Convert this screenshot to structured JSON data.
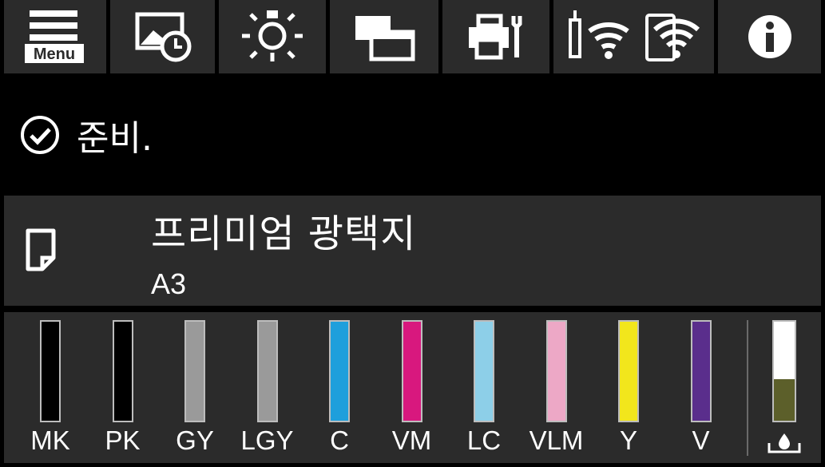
{
  "status": {
    "message": "준비."
  },
  "paper": {
    "type": "프리미엄 광택지",
    "size": "A3"
  },
  "toolbar": {
    "menu_label": "Menu",
    "buttons": [
      "menu-icon",
      "photo-timer-icon",
      "light-icon",
      "layout-icon",
      "printer-maintenance-icon",
      "wifi-icon",
      "wifi-direct-icon",
      "info-icon"
    ]
  },
  "inks": [
    {
      "name": "MK",
      "color": "#000000",
      "level": 1.0
    },
    {
      "name": "PK",
      "color": "#000000",
      "level": 1.0
    },
    {
      "name": "GY",
      "color": "#9a9a9a",
      "level": 1.0
    },
    {
      "name": "LGY",
      "color": "#9a9a9a",
      "level": 1.0
    },
    {
      "name": "C",
      "color": "#1e9fdc",
      "level": 1.0
    },
    {
      "name": "VM",
      "color": "#d8187e",
      "level": 1.0
    },
    {
      "name": "LC",
      "color": "#8dcfe8",
      "level": 1.0
    },
    {
      "name": "VLM",
      "color": "#eda8c6",
      "level": 1.0
    },
    {
      "name": "Y",
      "color": "#f2e61c",
      "level": 1.0
    },
    {
      "name": "V",
      "color": "#5a2e8c",
      "level": 1.0
    }
  ],
  "maintenance_box": {
    "used_level": 0.42,
    "used_color": "#5c5f2a"
  }
}
